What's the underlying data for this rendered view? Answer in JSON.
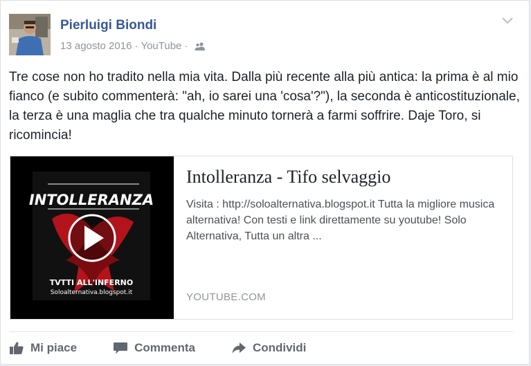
{
  "post": {
    "author": "Pierluigi Biondi",
    "date": "13 agosto 2016",
    "separator": "·",
    "source": "YouTube",
    "audience_icon": "friends-icon",
    "text": "Tre cose non ho tradito nella mia vita. Dalla più recente alla più antica: la prima è al mio fianco (e subito commenterà: \"ah, io sarei una 'cosa'?\"), la seconda è anticostituzionale, la terza è una maglia che tra qualche minuto tornerà a farmi soffrire. Daje Toro, si ricomincia!"
  },
  "link": {
    "title": "Intolleranza - Tifo selvaggio",
    "description": "Visita : http://soloalternativa.blogspot.it Tutta la migliore musica alternativa! Con testi e link direttamente su youtube! Solo Alternativa, Tutta un altra ...",
    "domain": "YOUTUBE.COM",
    "thumbnail": {
      "band": "INTOLLERANZA",
      "album": "TVTTI ALL'INFERNO",
      "site": "Soloalternativa.blogspot.it"
    }
  },
  "actions": {
    "like": "Mi piace",
    "comment": "Commenta",
    "share": "Condividi"
  },
  "colors": {
    "author_link": "#365899",
    "meta_gray": "#90949c",
    "action_gray": "#616770",
    "thumb_red": "#b3141b"
  }
}
